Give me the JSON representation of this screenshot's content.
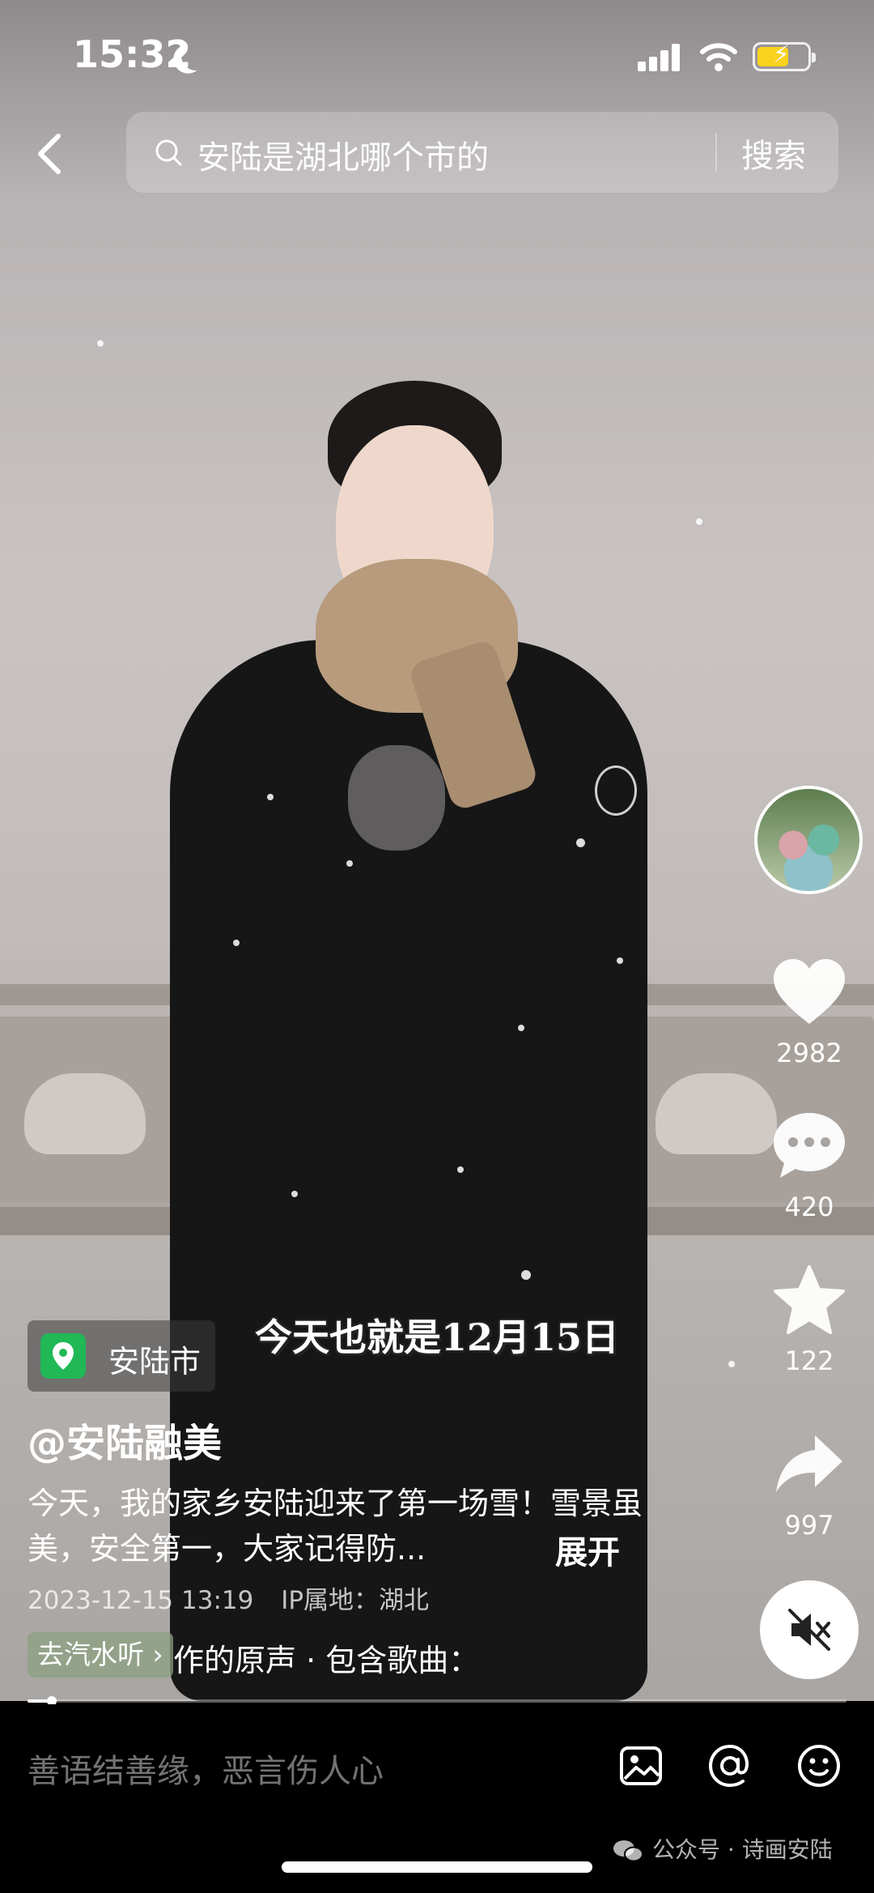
{
  "status_bar": {
    "time": "15:32",
    "battery_color": "#f8d21c"
  },
  "search": {
    "query": "安陆是湖北哪个市的",
    "button": "搜索"
  },
  "video": {
    "subtitle": "今天也就是12月15日",
    "progress_fraction": 0.03
  },
  "actions": {
    "likes": "2982",
    "comments": "420",
    "favorites": "122",
    "shares": "997"
  },
  "info": {
    "location": "安陆市",
    "author": "@安陆融美",
    "description": "今天，我的家乡安陆迎来了第一场雪！雪景虽美，安全第一，大家记得防...",
    "expand": "展开",
    "date": "2023-12-15 13:19",
    "ip": "IP属地：湖北",
    "music_chip": "去汽水听",
    "music_text": "作的原声 · 包含歌曲："
  },
  "comment": {
    "placeholder": "善语结善缘，恶言伤人心"
  },
  "watermark": "公众号 · 诗画安陆",
  "colors": {
    "location_green": "#21b856",
    "like_white": "#ffffff"
  }
}
